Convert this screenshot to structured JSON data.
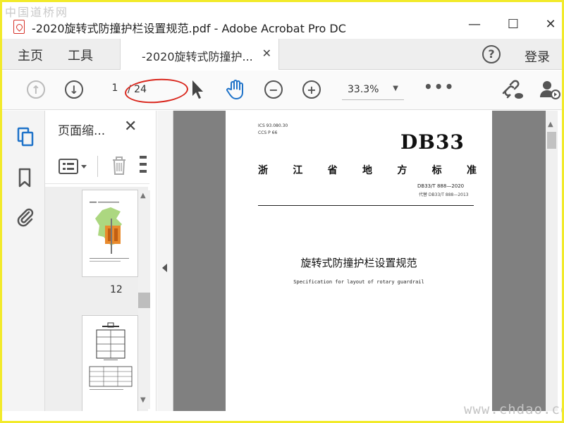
{
  "watermark": {
    "top": "中国道桥网",
    "bottom": "www.chdao.com"
  },
  "window": {
    "title": "-2020旋转式防撞护栏设置规范.pdf - Adobe Acrobat Pro DC",
    "minimize": "—",
    "maximize": "☐",
    "close": "✕"
  },
  "menu": {
    "home": "主页",
    "tools": "工具",
    "tab_label": "-2020旋转式防撞护...",
    "tab_close": "✕",
    "help": "?",
    "login": "登录"
  },
  "toolbar": {
    "prev_page": "↑",
    "next_page": "↓",
    "current_page": "1",
    "total_pages": "/ 24",
    "zoom_out": "−",
    "zoom_in": "+",
    "zoom_value": "33.3%",
    "zoom_caret": "▼",
    "more": "•••",
    "highlight_color": "#d9261c"
  },
  "thumbnails": {
    "title": "页面缩...",
    "close": "✕",
    "page_label": "12"
  },
  "document": {
    "ics": "ICS  93.080.30",
    "ccs": "CCS P 66",
    "standard": "DB33",
    "province": [
      "浙",
      "江",
      "省",
      "地",
      "方",
      "标",
      "准"
    ],
    "code": "DB33/T 888—2020",
    "replaces": "代替 DB33/T 888—2013",
    "title_cn": "旋转式防撞护栏设置规范",
    "title_en": "Specification for layout of rotary guardrail"
  },
  "colors": {
    "frame": "#f2ea2a",
    "accent_blue": "#1f73c9",
    "pdf_red": "#d6332a"
  }
}
